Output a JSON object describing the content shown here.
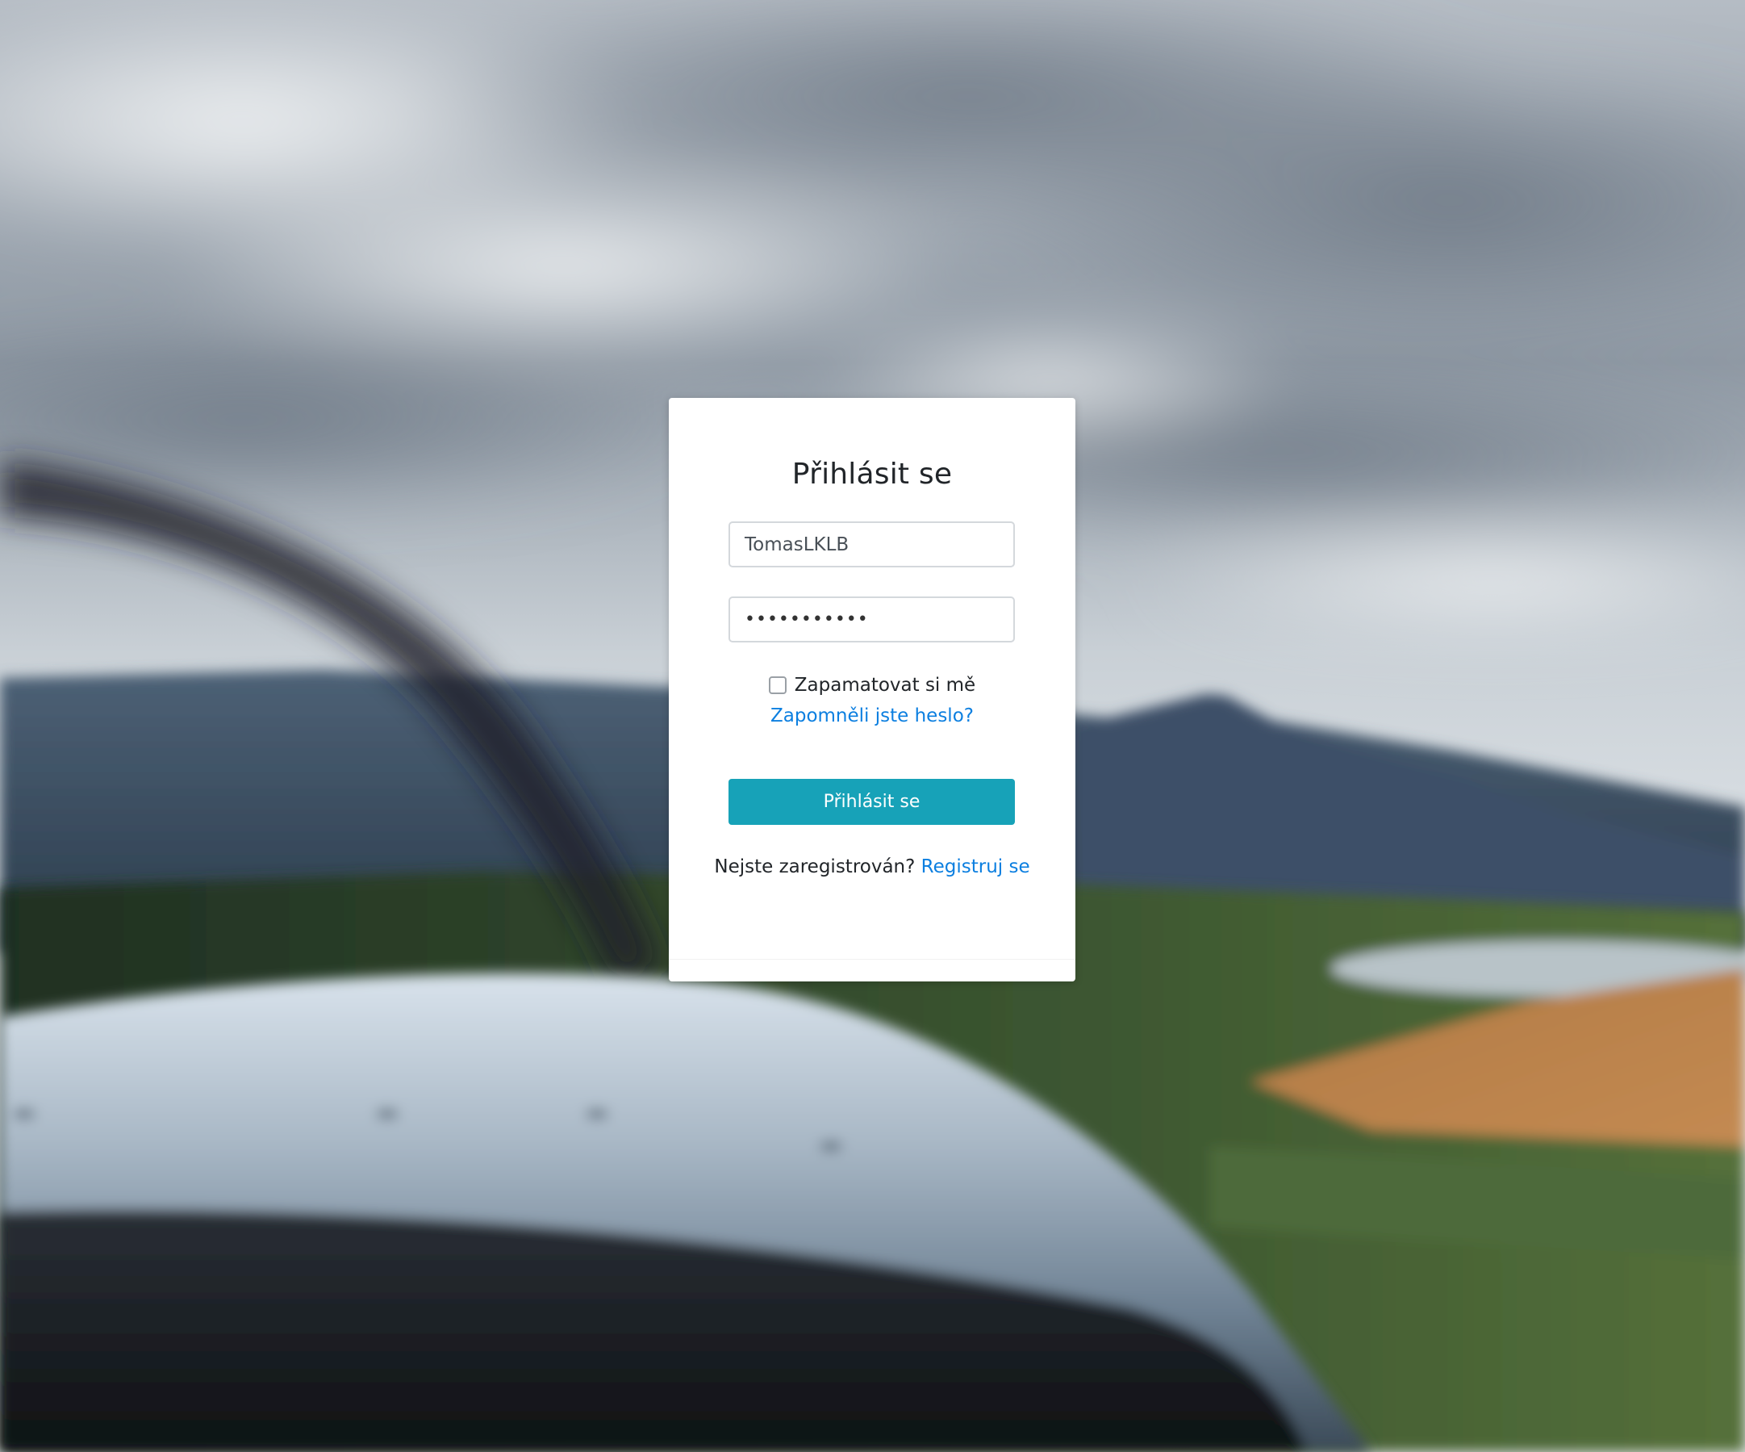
{
  "login": {
    "title": "Přihlásit se",
    "username_value": "TomasLKLB",
    "password_value": "•••••••••••",
    "remember_label": "Zapamatovat si mě",
    "forgot_link": "Zapomněli jste heslo?",
    "submit_label": "Přihlásit se",
    "register_prompt": "Nejste zaregistrován?",
    "register_link": "Registruj se"
  },
  "colors": {
    "button": "#17a2b8",
    "link": "#0c7fe0",
    "card": "#ffffff"
  }
}
